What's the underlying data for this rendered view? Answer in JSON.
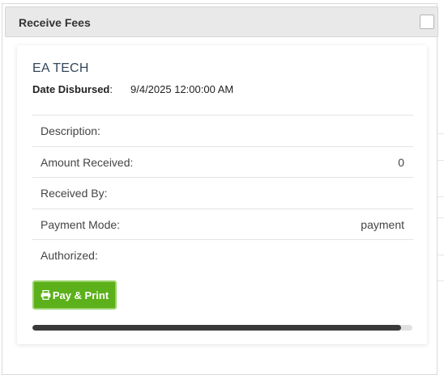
{
  "modal": {
    "title": "Receive Fees"
  },
  "fee": {
    "company": "EA TECH",
    "date_label": "Date Disbursed",
    "date_colon": ":",
    "date_value": "9/4/2025 12:00:00 AM",
    "rows": [
      {
        "label": "Description:",
        "value": ""
      },
      {
        "label": "Amount Received:",
        "value": "0"
      },
      {
        "label": "Received By:",
        "value": ""
      },
      {
        "label": "Payment Mode:",
        "value": "payment"
      },
      {
        "label": "Authorized:",
        "value": ""
      }
    ]
  },
  "actions": {
    "pay_print_label": "Pay & Print",
    "pay_print_icon": "print-icon",
    "button_color": "#5cb01a"
  },
  "progress": {
    "fraction": 0.97
  }
}
